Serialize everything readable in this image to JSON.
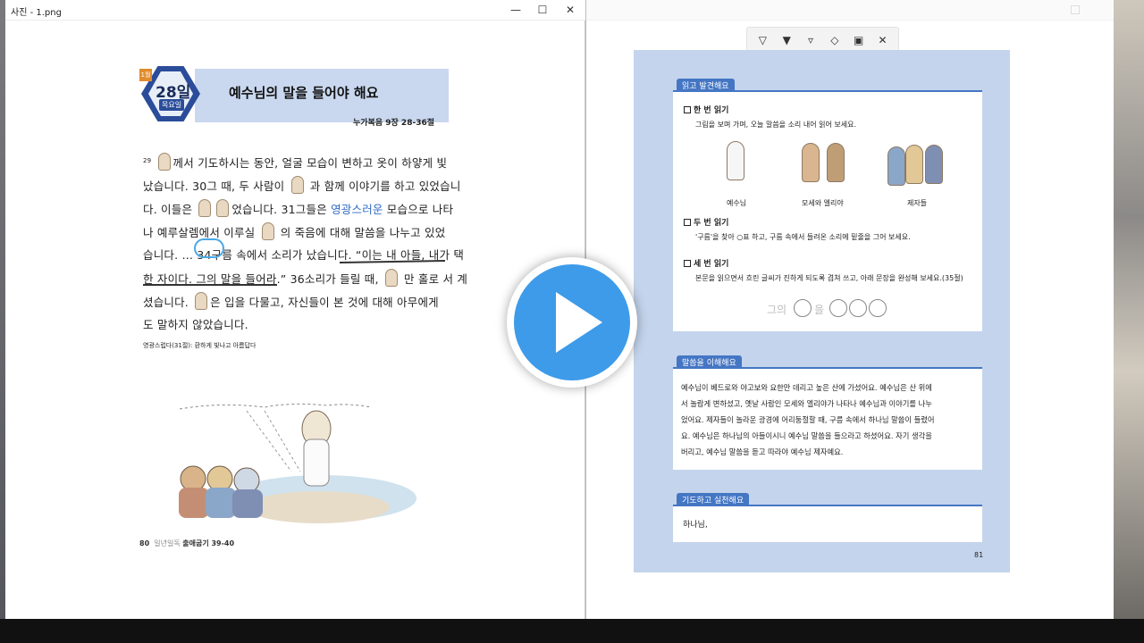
{
  "window": {
    "title": "사진 - 1.png",
    "minimize": "—",
    "maximize": "☐",
    "close": "✕"
  },
  "toolbar": {
    "tools": [
      "ballpoint-pen-icon",
      "pencil-icon",
      "highlighter-icon",
      "eraser-icon",
      "save-icon",
      "close-icon"
    ]
  },
  "left_page": {
    "badge_top": "1월",
    "day": "28일",
    "weekday": "목요일",
    "title": "예수님의 말을 들어야 해요",
    "reference": "누가복음 9장 28-36절",
    "verses": [
      {
        "pre": "29",
        "a": "께서 기도하시는 동안, 얼굴 모습이 변하고 옷이 하얗게 빛",
        "b": ""
      },
      {
        "pre": "",
        "a": "났습니다. 30그 때, 두 사람이",
        "b": "과 함께 이야기를 하고 있었습니"
      },
      {
        "pre": "",
        "a": "다. 이들은",
        "b": "었습니다. 31그들은"
      },
      {
        "pre": "",
        "a": "나 예루살렘에서 이루실",
        "b": "의 죽음에 대해 말씀을 나누고 있었"
      },
      {
        "pre": "",
        "a": "습니다. … 34구름 속에서 소리가 났습니다. “이는 내 아들, 내가 택",
        "b": ""
      },
      {
        "pre": "",
        "a": "한 자이다. 그의 말을 들어라.” 36소리가 들릴 때,",
        "b": "만 홀로 서 계"
      },
      {
        "pre": "",
        "a": "셨습니다.",
        "b": "은 입을 다물고, 자신들이 본 것에 대해 아무에게"
      },
      {
        "pre": "",
        "a": "도 말하지 않았습니다.",
        "b": ""
      }
    ],
    "highlight_word": "영광스러운",
    "line3_tail": "모습으로 나타",
    "footnote": "영광스럽다(31절): 환하게 빛나고 아름답다",
    "footer_page": "80",
    "footer_label": "일년일독",
    "footer_ref": "출애굽기 39-40"
  },
  "right_page": {
    "section1_tag": "읽고 발견해요",
    "read1_label": "한 번 읽기",
    "read1_text": "그림을 보며 가며, 오늘 말씀을 소리 내어 읽어 보세요.",
    "captions": [
      "예수님",
      "모세와 엘리야",
      "제자들"
    ],
    "read2_label": "두 번 읽기",
    "read2_text": "'구름'을 찾아 ○표 하고, 구름 속에서 들려온 소리에 밑줄을 그어 보세요.",
    "read3_label": "세 번 읽기",
    "read3_text": "본문을 읽으면서 흐린 글씨가 진하게 되도록 겹쳐 쓰고, 아래 문장을 완성해 보세요.(35절)",
    "blank_sentence_a": "그의",
    "blank_sentence_b": "을",
    "section2_tag": "말씀을 이해해요",
    "para": [
      "예수님이 베드로와 야고보와 요한만 데리고 높은 산에 가셨어요. 예수님은 산 위에",
      "서 놀랍게 변하셨고, 옛날 사람인 모세와 엘리야가 나타나 예수님과 이야기를 나누",
      "었어요. 제자들이 놀라운 광경에 어리둥절할 때, 구름 속에서 하나님 말씀이 들렸어",
      "요. 예수님은 하나님의 아들이시니 예수님 말씀을 들으라고 하셨어요. 자기 생각을",
      "버리고, 예수님 말씀을 듣고 따라야 예수님 제자예요."
    ],
    "section3_tag": "기도하고 실천해요",
    "prayer": "하나님,",
    "page_num": "81"
  },
  "colors": {
    "accent": "#4476c4",
    "page_bg": "#c4d4ec",
    "play": "#3d9be9"
  },
  "play_button": "play-icon"
}
